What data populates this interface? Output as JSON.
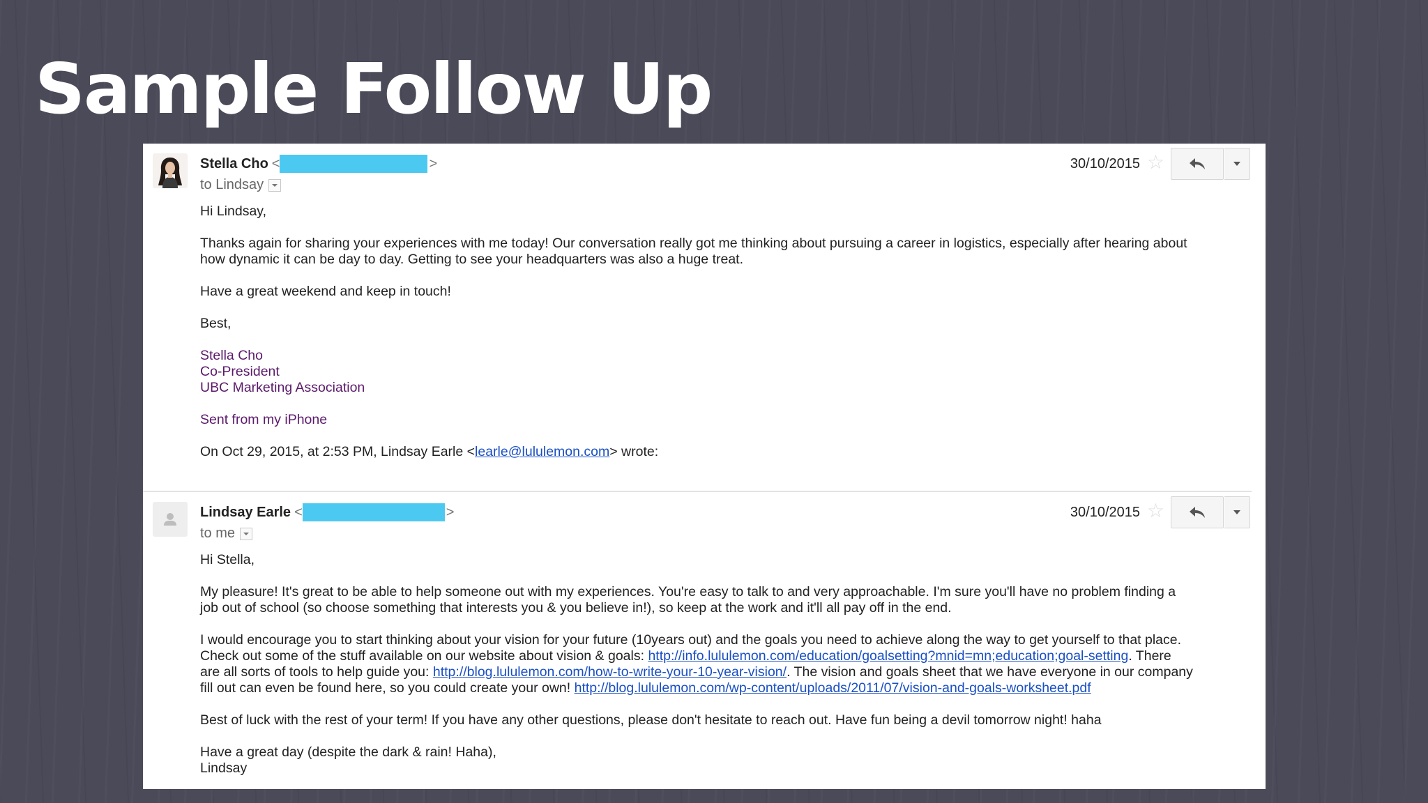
{
  "slide": {
    "title": "Sample Follow Up"
  },
  "messages": [
    {
      "sender": "Stella Cho",
      "open_angle": "<",
      "close_angle": ">",
      "recipient_line": "to Lindsay",
      "date": "30/10/2015",
      "greeting": "Hi Lindsay,",
      "paragraphs": [
        "Thanks again for sharing your experiences with me today! Our conversation really got me thinking about pursuing a career in logistics, especially after hearing about\nhow dynamic it can be day to day. Getting to see your headquarters was also a huge treat.",
        "Have a great weekend and keep in touch!",
        "Best,"
      ],
      "signature": "Stella Cho\nCo-President\nUBC Marketing Association",
      "sent_from": "Sent from my iPhone",
      "quote": {
        "prefix": "On Oct 29, 2015, at 2:53 PM, Lindsay Earle <",
        "email": "learle@lululemon.com",
        "suffix": "> wrote:"
      }
    },
    {
      "sender": "Lindsay Earle",
      "open_angle": "<",
      "close_angle": ">",
      "recipient_line": "to me",
      "date": "30/10/2015",
      "greeting": "Hi Stella,",
      "paragraphs": [
        "My pleasure! It's great to be able to help someone out with my experiences. You're easy to talk to and very approachable. I'm sure you'll have no problem finding a\njob out of school (so choose something that interests you & you believe in!), so keep at the work and it'll all pay off in the end."
      ],
      "vision": {
        "part1": "I would encourage you to start thinking about your vision for your future (10years out) and the goals you need to achieve along the way to get yourself to that place.\nCheck out some of the stuff available on our website about vision & goals: ",
        "link1": "http://info.lululemon.com/education/goalsetting?mnid=mn;education;goal-setting",
        "part2": ". There\nare all sorts of tools to help guide you: ",
        "link2": "http://blog.lululemon.com/how-to-write-your-10-year-vision/",
        "part3": ". The vision and goals sheet that we have everyone in our company\nfill out can even be found here, so you could create your own! ",
        "link3": "http://blog.lululemon.com/wp-content/uploads/2011/07/vision-and-goals-worksheet.pdf"
      },
      "closing": "Best of luck with the rest of your term! If you have any other questions, please don't hesitate to reach out. Have fun being a devil tomorrow night! haha",
      "signoff": "Have a great day (despite the dark & rain! Haha),\nLindsay"
    }
  ],
  "colors": {
    "redaction": "#4cc9f0",
    "link": "#1a4fc4",
    "signature": "#5b1a6b",
    "slide_background": "#4b4a58"
  }
}
